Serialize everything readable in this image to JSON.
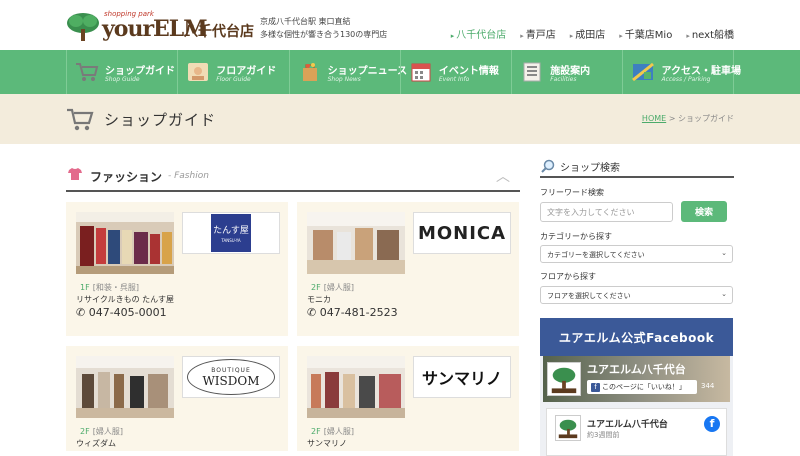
{
  "header": {
    "logo_small": "shopping park",
    "logo_brand": "yourELM",
    "logo_store": "八千代台店",
    "tagline_1": "京成八千代台駅 東口直結",
    "tagline_2": "多様な個性が響き合う130の専門店",
    "store_links": [
      {
        "label": "八千代台店",
        "active": true
      },
      {
        "label": "青戸店",
        "active": false
      },
      {
        "label": "成田店",
        "active": false
      },
      {
        "label": "千葉店Mio",
        "active": false
      },
      {
        "label": "next船橋",
        "active": false
      }
    ]
  },
  "nav": [
    {
      "label": "ショップガイド",
      "sub": "Shop Guide",
      "icon": "cart-icon"
    },
    {
      "label": "フロアガイド",
      "sub": "Floor Guide",
      "icon": "floor-icon"
    },
    {
      "label": "ショップニュース",
      "sub": "Shop News",
      "icon": "shopping-bag-icon"
    },
    {
      "label": "イベント情報",
      "sub": "Event Info",
      "icon": "calendar-icon"
    },
    {
      "label": "施設案内",
      "sub": "Facilities",
      "icon": "document-icon"
    },
    {
      "label": "アクセス・駐車場",
      "sub": "Access / Parking",
      "icon": "map-icon"
    }
  ],
  "banner": {
    "title": "ショップガイド",
    "breadcrumb_home": "HOME",
    "breadcrumb_sep": ">",
    "breadcrumb_current": "ショップガイド"
  },
  "section": {
    "title": "ファッション",
    "subtitle": "- Fashion"
  },
  "shops": [
    {
      "floor": "1F",
      "category": "[和装・呉服]",
      "name": "リサイクルきもの たんす屋",
      "tel": "047-405-0001",
      "logo_text": "たんす屋",
      "logo_sub": "TANSU-YA"
    },
    {
      "floor": "2F",
      "category": "[婦人服]",
      "name": "モニカ",
      "tel": "047-481-2523",
      "logo_text": "MONICA"
    },
    {
      "floor": "2F",
      "category": "[婦人服]",
      "name": "ウィズダム",
      "logo_text": "WISDOM",
      "logo_sub": "BOUTIQUE"
    },
    {
      "floor": "2F",
      "category": "[婦人服]",
      "name": "サンマリノ",
      "logo_text": "サンマリノ"
    }
  ],
  "sidebar": {
    "title": "ショップ検索",
    "keyword_label": "フリーワード検索",
    "keyword_placeholder": "文字を入力してください",
    "search_button": "検索",
    "category_label": "カテゴリーから探す",
    "category_selected": "カテゴリーを選択してください",
    "floor_label": "フロアから探す",
    "floor_selected": "フロアを選択してください"
  },
  "facebook": {
    "heading": "ユアエルム公式Facebook",
    "page_name": "ユアエルム八千代台",
    "like_label": "このページに「いいね！」",
    "like_count": "344",
    "post_name": "ユアエルム八千代台",
    "post_time": "約3週間前"
  },
  "colors": {
    "green": "#5cb97a",
    "beige": "#f3ecdc",
    "facebook": "#3b5998"
  }
}
